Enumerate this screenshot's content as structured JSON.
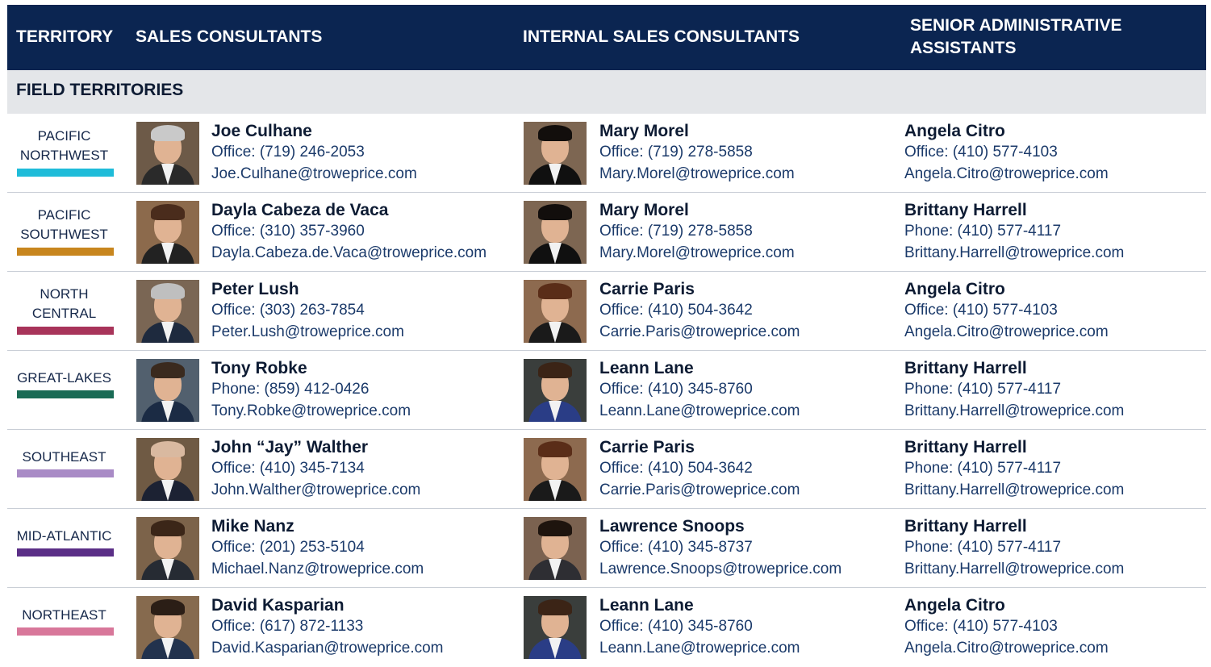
{
  "header": {
    "territory": "TERRITORY",
    "sales": "SALES CONSULTANTS",
    "internal": "INTERNAL SALES CONSULTANTS",
    "senior_line1": "SENIOR ADMINISTRATIVE",
    "senior_line2": "ASSISTANTS",
    "color": "#0b2551"
  },
  "section_title": "FIELD TERRITORIES",
  "rows": [
    {
      "territory": [
        "PACIFIC",
        "NORTHWEST"
      ],
      "bar_color": "#1fbcd9",
      "sales": {
        "name": "Joe Culhane",
        "phone": "Office: (719) 246-2053",
        "email": "Joe.Culhane@troweprice.com"
      },
      "internal": {
        "name": "Mary Morel",
        "phone": "Office: (719) 278-5858",
        "email": "Mary.Morel@troweprice.com"
      },
      "admin": {
        "name": "Angela Citro",
        "phone": "Office: (410) 577-4103",
        "email": "Angela.Citro@troweprice.com"
      }
    },
    {
      "territory": [
        "PACIFIC",
        "SOUTHWEST"
      ],
      "bar_color": "#c8861e",
      "sales": {
        "name": "Dayla Cabeza de Vaca",
        "phone": "Office: (310) 357-3960",
        "email": "Dayla.Cabeza.de.Vaca@troweprice.com"
      },
      "internal": {
        "name": "Mary Morel",
        "phone": "Office: (719) 278-5858",
        "email": "Mary.Morel@troweprice.com"
      },
      "admin": {
        "name": "Brittany Harrell",
        "phone": "Phone: (410) 577-4117",
        "email": "Brittany.Harrell@troweprice.com"
      }
    },
    {
      "territory": [
        "NORTH",
        "CENTRAL"
      ],
      "bar_color": "#a8345a",
      "sales": {
        "name": "Peter Lush",
        "phone": "Office: (303) 263-7854",
        "email": "Peter.Lush@troweprice.com"
      },
      "internal": {
        "name": "Carrie Paris",
        "phone": "Office: (410) 504-3642",
        "email": "Carrie.Paris@troweprice.com"
      },
      "admin": {
        "name": "Angela Citro",
        "phone": "Office: (410) 577-4103",
        "email": "Angela.Citro@troweprice.com"
      }
    },
    {
      "territory": [
        "GREAT-LAKES"
      ],
      "bar_color": "#1a6b55",
      "sales": {
        "name": "Tony Robke",
        "phone": "Phone: (859) 412-0426",
        "email": "Tony.Robke@troweprice.com"
      },
      "internal": {
        "name": "Leann Lane",
        "phone": "Office: (410) 345-8760",
        "email": "Leann.Lane@troweprice.com"
      },
      "admin": {
        "name": "Brittany Harrell",
        "phone": "Phone: (410) 577-4117",
        "email": "Brittany.Harrell@troweprice.com"
      }
    },
    {
      "territory": [
        "SOUTHEAST"
      ],
      "bar_color": "#a98bc6",
      "sales": {
        "name": "John “Jay” Walther",
        "phone": "Office: (410) 345-7134",
        "email": "John.Walther@troweprice.com"
      },
      "internal": {
        "name": "Carrie Paris",
        "phone": "Office: (410) 504-3642",
        "email": "Carrie.Paris@troweprice.com"
      },
      "admin": {
        "name": "Brittany Harrell",
        "phone": "Phone: (410) 577-4117",
        "email": "Brittany.Harrell@troweprice.com"
      }
    },
    {
      "territory": [
        "MID-ATLANTIC"
      ],
      "bar_color": "#5b2f87",
      "sales": {
        "name": "Mike Nanz",
        "phone": "Office: (201) 253-5104",
        "email": "Michael.Nanz@troweprice.com"
      },
      "internal": {
        "name": "Lawrence Snoops",
        "phone": "Office: (410) 345-8737",
        "email": "Lawrence.Snoops@troweprice.com"
      },
      "admin": {
        "name": "Brittany Harrell",
        "phone": "Phone: (410) 577-4117",
        "email": "Brittany.Harrell@troweprice.com"
      }
    },
    {
      "territory": [
        "NORTHEAST"
      ],
      "bar_color": "#d8779a",
      "sales": {
        "name": "David Kasparian",
        "phone": "Office: (617) 872-1133",
        "email": "David.Kasparian@troweprice.com"
      },
      "internal": {
        "name": "Leann Lane",
        "phone": "Office: (410) 345-8760",
        "email": "Leann.Lane@troweprice.com"
      },
      "admin": {
        "name": "Angela Citro",
        "phone": "Office: (410) 577-4103",
        "email": "Angela.Citro@troweprice.com"
      }
    }
  ]
}
